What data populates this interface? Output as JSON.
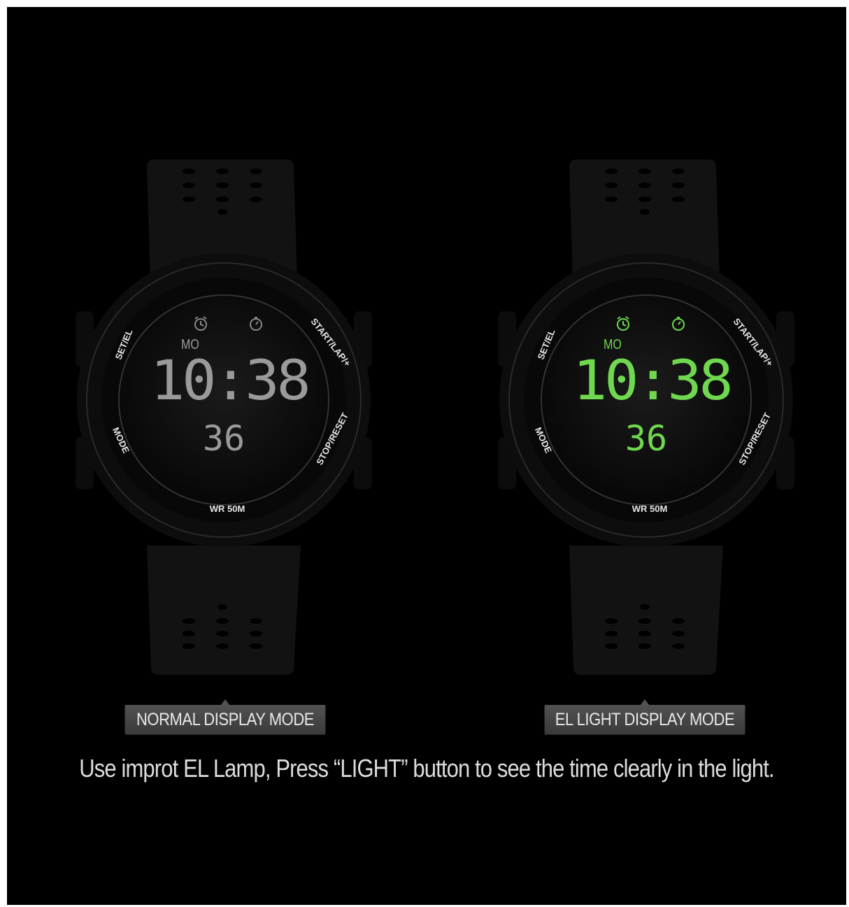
{
  "watches": [
    {
      "day": "MO",
      "time": "10:38",
      "seconds": "36",
      "bezel": {
        "set_el": "SET/EL",
        "mode": "MODE",
        "start_lap": "START/LAP/+",
        "stop_reset": "STOP/RESET",
        "wr": "WR 50M"
      },
      "display_color": "#9a9a9a",
      "label": "NORMAL DISPLAY MODE"
    },
    {
      "day": "MO",
      "time": "10:38",
      "seconds": "36",
      "bezel": {
        "set_el": "SET/EL",
        "mode": "MODE",
        "start_lap": "START/LAP/+",
        "stop_reset": "STOP/RESET",
        "wr": "WR 50M"
      },
      "display_color": "#6fd84f",
      "label": "EL LIGHT DISPLAY MODE"
    }
  ],
  "caption": "Use improt EL Lamp, Press “LIGHT” button to see the time clearly in the light.",
  "colors": {
    "background": "#000000",
    "strap": "#101010",
    "label_bg": "#4a4a4a"
  }
}
